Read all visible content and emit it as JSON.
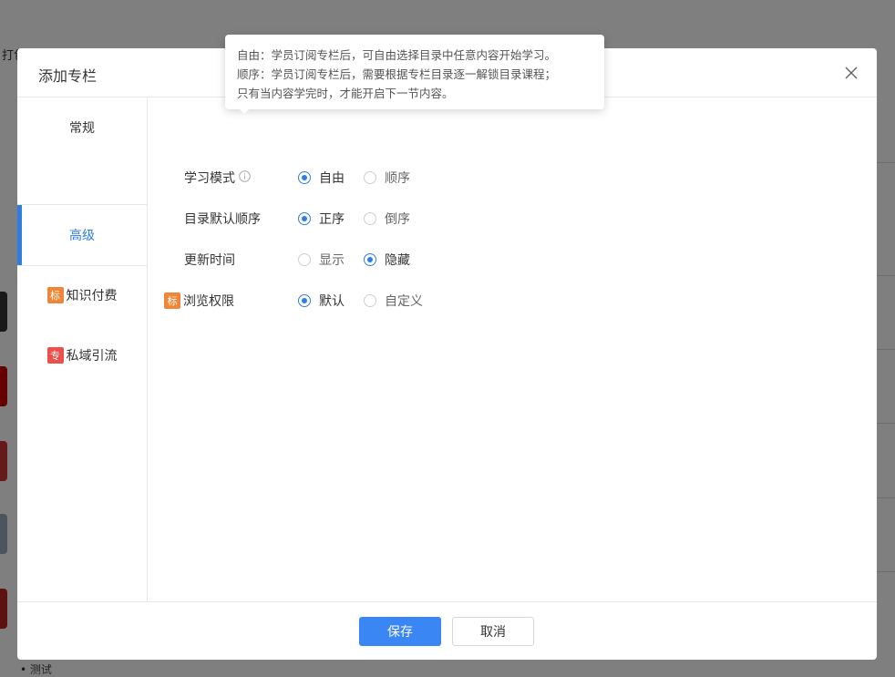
{
  "background": {
    "partial_text": "打包",
    "bottom_text": "• 测试"
  },
  "modal": {
    "title": "添加专栏",
    "sidebar": [
      {
        "label": "常规",
        "tag": ""
      },
      {
        "label": "高级",
        "tag": ""
      },
      {
        "label": "知识付费",
        "tag": "标"
      },
      {
        "label": "私域引流",
        "tag": "专"
      }
    ],
    "form": {
      "study_mode": {
        "label": "学习模式",
        "options": [
          "自由",
          "顺序"
        ],
        "selected": 0
      },
      "catalog_order": {
        "label": "目录默认顺序",
        "options": [
          "正序",
          "倒序"
        ],
        "selected": 0
      },
      "update_time": {
        "label": "更新时间",
        "options": [
          "显示",
          "隐藏"
        ],
        "selected": 1
      },
      "browse_permission": {
        "label": "浏览权限",
        "tag": "标",
        "options": [
          "默认",
          "自定义"
        ],
        "selected": 0
      }
    },
    "tooltip": [
      "自由：学员订阅专栏后，可自由选择目录中任意内容开始学习。",
      "顺序：学员订阅专栏后，需要根据专栏目录逐一解锁目录课程；",
      "只有当内容学完时，才能开启下一节内容。"
    ],
    "footer": {
      "save": "保存",
      "cancel": "取消"
    }
  },
  "colors": {
    "accent": "#2f7de1",
    "tag_orange": "#f08537",
    "tag_red": "#ee4f4a"
  }
}
